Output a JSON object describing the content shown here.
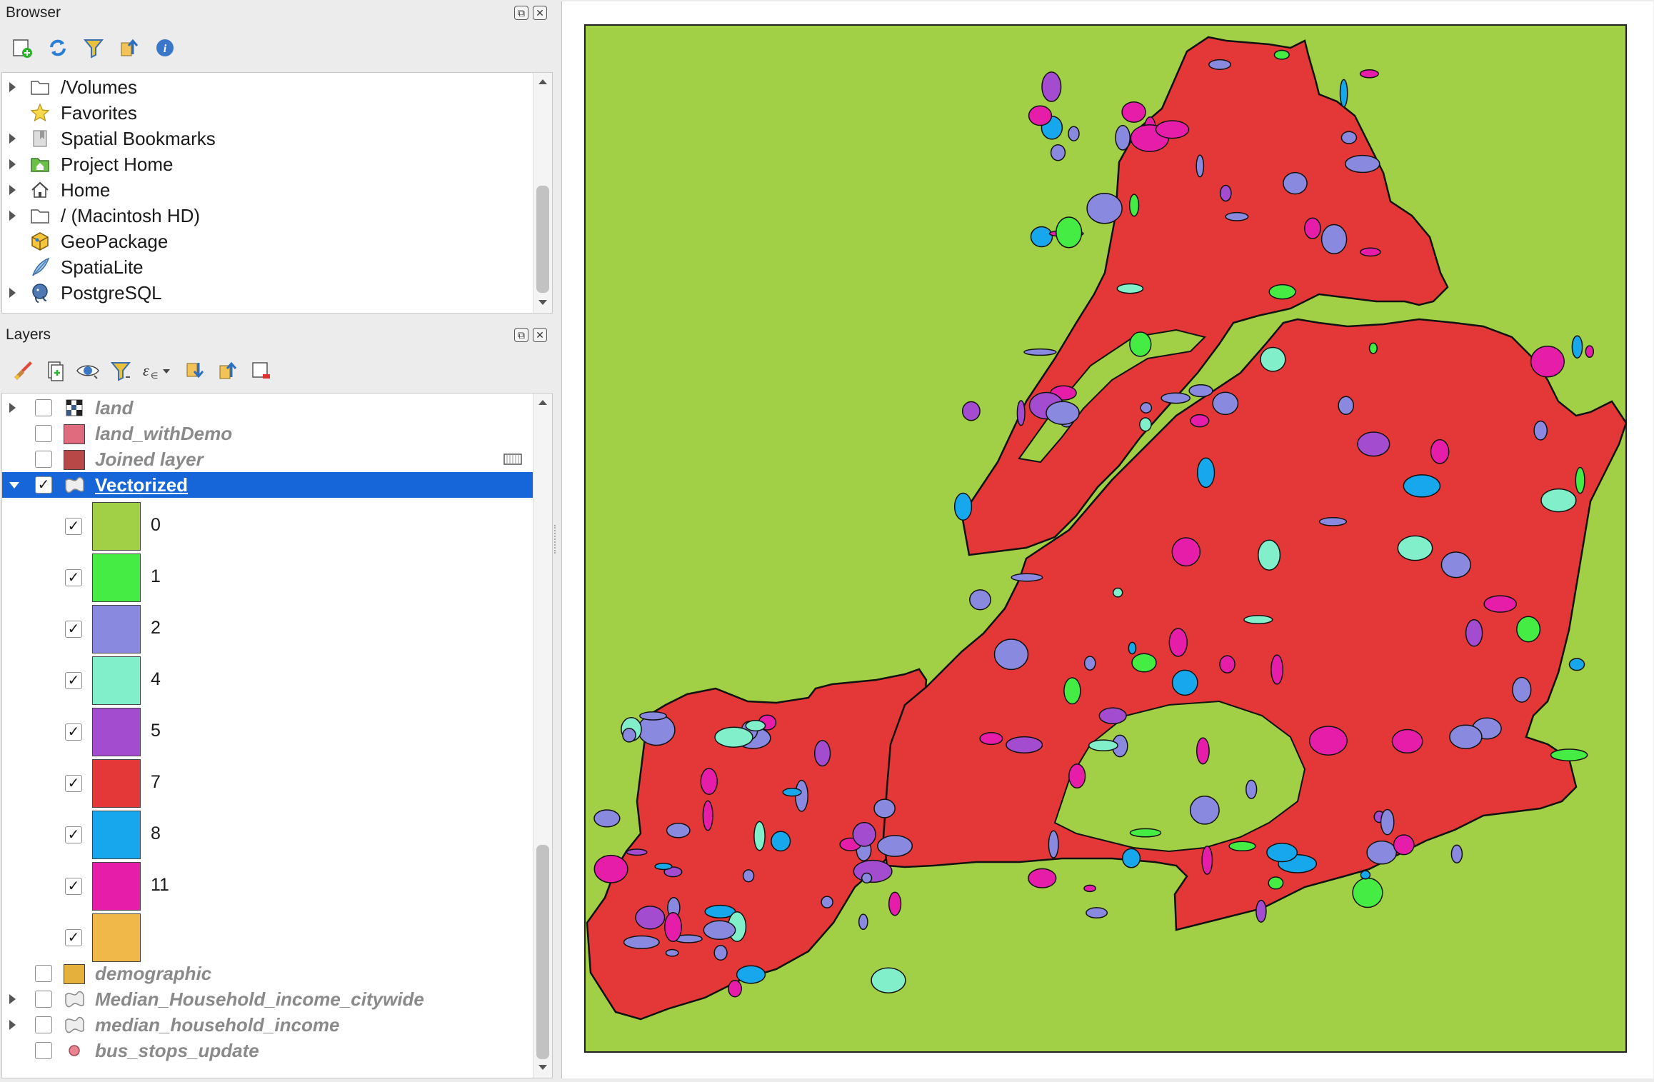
{
  "browser": {
    "title": "Browser",
    "items": [
      {
        "label": "/Volumes",
        "icon": "folder-icon",
        "expandable": true
      },
      {
        "label": "Favorites",
        "icon": "star-icon",
        "expandable": false
      },
      {
        "label": "Spatial Bookmarks",
        "icon": "bookmark-icon",
        "expandable": true
      },
      {
        "label": "Project Home",
        "icon": "project-home-icon",
        "expandable": true
      },
      {
        "label": "Home",
        "icon": "home-icon",
        "expandable": true
      },
      {
        "label": "/ (Macintosh HD)",
        "icon": "folder-icon",
        "expandable": true
      },
      {
        "label": "GeoPackage",
        "icon": "geopackage-icon",
        "expandable": false
      },
      {
        "label": "SpatiaLite",
        "icon": "spatialite-icon",
        "expandable": false
      },
      {
        "label": "PostgreSQL",
        "icon": "postgresql-icon",
        "expandable": true
      }
    ]
  },
  "layers": {
    "title": "Layers",
    "items": [
      {
        "label": "land",
        "icon": "raster-icon",
        "checked": false,
        "expandable": true
      },
      {
        "label": "land_withDemo",
        "swatch": "#e06a7e",
        "checked": false
      },
      {
        "label": "Joined layer",
        "swatch": "#b84848",
        "checked": false
      },
      {
        "label": "Vectorized",
        "icon": "polygon-layer-icon",
        "checked": true,
        "selected": true
      }
    ],
    "categories": [
      {
        "label": "0",
        "color": "#a1cf45"
      },
      {
        "label": "1",
        "color": "#44ec44"
      },
      {
        "label": "2",
        "color": "#8a89e0"
      },
      {
        "label": "4",
        "color": "#82efcb"
      },
      {
        "label": "5",
        "color": "#a34cd0"
      },
      {
        "label": "7",
        "color": "#e43838"
      },
      {
        "label": "8",
        "color": "#17a7ec"
      },
      {
        "label": "11",
        "color": "#e51da9"
      },
      {
        "label": "",
        "color": "#efb848"
      }
    ],
    "more_items": [
      {
        "label": "demographic",
        "swatch": "#e6b13a",
        "checked": false
      },
      {
        "label": "Median_Household_income_citywide",
        "icon": "polygon-layer-icon",
        "checked": false,
        "expandable": true
      },
      {
        "label": "median_household_income",
        "icon": "polygon-layer-icon",
        "checked": false,
        "expandable": true
      },
      {
        "label": "bus_stops_update",
        "icon": "point-layer-icon",
        "checked": false
      }
    ]
  },
  "map": {
    "background_color": "#a1cf45",
    "land_color": "#e43838"
  }
}
